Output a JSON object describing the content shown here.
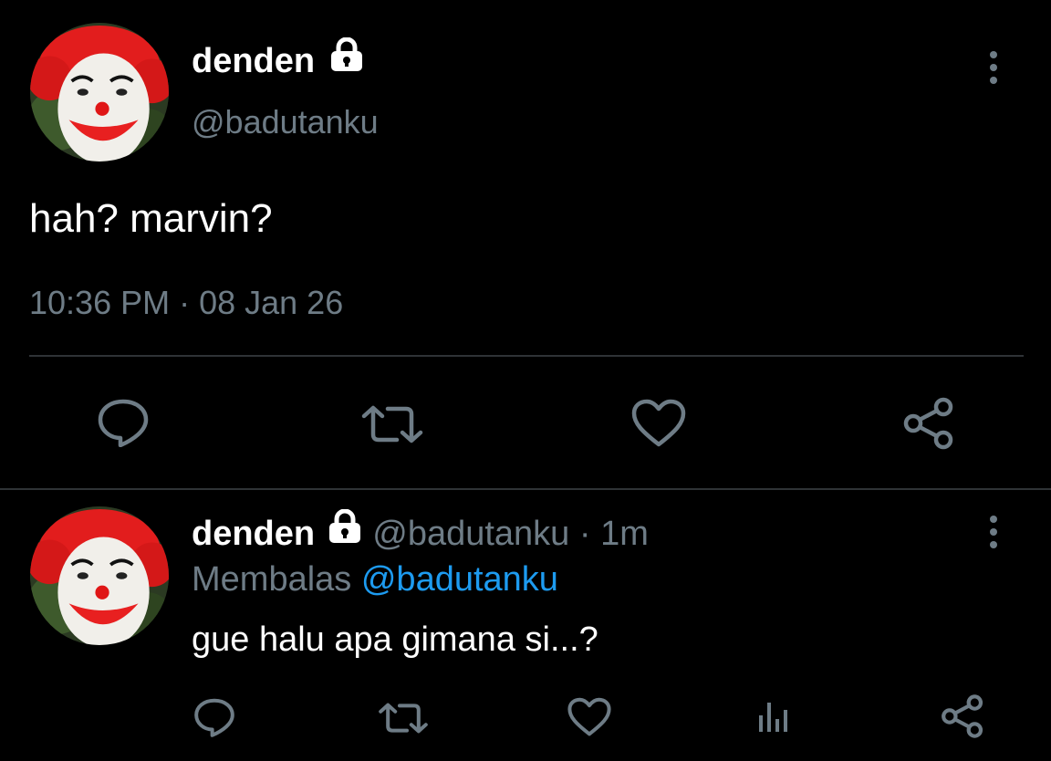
{
  "colors": {
    "background": "#000000",
    "text": "#ffffff",
    "muted": "#6e7c86",
    "link": "#1d9bf0",
    "divider": "#2f3336"
  },
  "main_tweet": {
    "display_name": "denden",
    "handle": "@badutanku",
    "text": "hah? marvin?",
    "timestamp": "10:36 PM · 08 Jan 26",
    "icons": [
      "lock-icon",
      "more-icon",
      "reply-icon",
      "retweet-icon",
      "like-icon",
      "share-icon"
    ]
  },
  "reply_tweet": {
    "display_name": "denden",
    "handle": "@badutanku",
    "separator": "·",
    "time": "1m",
    "replying_prefix": "Membalas",
    "replying_to": "@badutanku",
    "text": "gue halu apa gimana si...?",
    "icons": [
      "lock-icon",
      "more-icon",
      "reply-icon",
      "retweet-icon",
      "like-icon",
      "analytics-icon",
      "share-icon"
    ]
  }
}
